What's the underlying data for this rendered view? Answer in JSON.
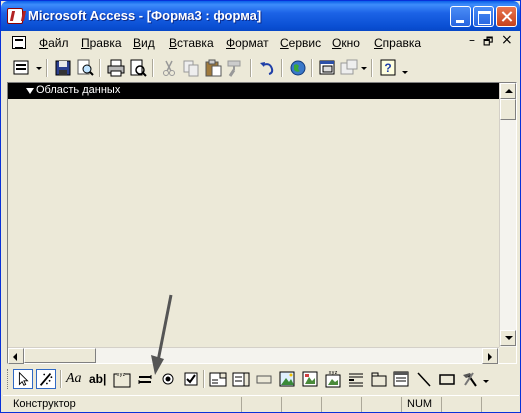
{
  "window": {
    "title": "Microsoft Access - [Форма3 : форма]"
  },
  "menubar": {
    "items": [
      "Файл",
      "Правка",
      "Вид",
      "Вставка",
      "Формат",
      "Сервис",
      "Окно",
      "Справка"
    ],
    "mdi_minimize": "–",
    "mdi_restore": "🗗",
    "mdi_close": "×"
  },
  "toolbar": {
    "icons": [
      "form-view-icon",
      "save-icon",
      "search-icon",
      "print-icon",
      "print-preview-icon",
      "cut-icon",
      "copy-icon",
      "paste-icon",
      "format-painter-icon",
      "undo-icon",
      "web-icon",
      "properties-icon",
      "build-icon",
      "help-icon"
    ]
  },
  "design": {
    "section_label": "Область данных"
  },
  "toolbox": {
    "label_aa": "Aa",
    "textbox_label": "ab|",
    "icons": [
      "select-objects-icon",
      "control-wizards-icon",
      "label-icon",
      "textbox-icon",
      "option-group-icon",
      "toggle-button-icon",
      "option-button-icon",
      "checkbox-icon",
      "combo-box-icon",
      "list-box-icon",
      "command-button-icon",
      "image-icon",
      "unbound-object-icon",
      "bound-object-icon",
      "page-break-icon",
      "tab-control-icon",
      "subform-icon",
      "line-icon",
      "rectangle-icon",
      "more-controls-icon"
    ]
  },
  "statusbar": {
    "mode": "Конструктор",
    "num": "NUM"
  }
}
